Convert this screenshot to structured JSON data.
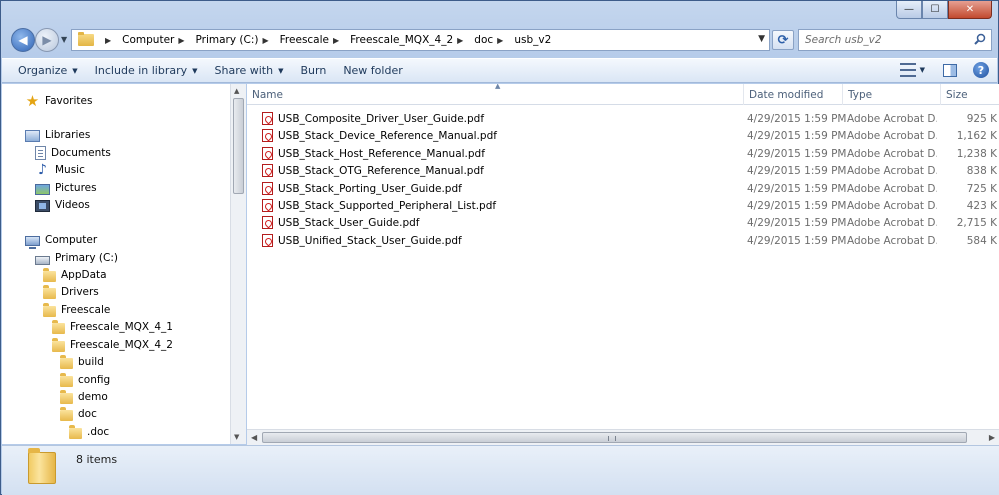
{
  "window": {
    "caption_buttons": {
      "minimize": "—",
      "maximize": "☐",
      "close": "✕"
    }
  },
  "address_bar": {
    "breadcrumbs": [
      "Computer",
      "Primary (C:)",
      "Freescale",
      "Freescale_MQX_4_2",
      "doc",
      "usb_v2"
    ]
  },
  "search": {
    "placeholder": "Search usb_v2"
  },
  "toolbar": {
    "organize": "Organize",
    "include_in_library": "Include in library",
    "share_with": "Share with",
    "burn": "Burn",
    "new_folder": "New folder",
    "help": "?"
  },
  "nav_pane": {
    "favorites": "Favorites",
    "libraries": "Libraries",
    "library_items": [
      "Documents",
      "Music",
      "Pictures",
      "Videos"
    ],
    "computer": "Computer",
    "drive": "Primary (C:)",
    "folders": [
      "AppData",
      "Drivers",
      "Freescale"
    ],
    "freescale_children": [
      "Freescale_MQX_4_1",
      "Freescale_MQX_4_2"
    ],
    "mqx42_children": [
      "build",
      "config",
      "demo",
      "doc"
    ],
    "doc_children": [
      ".doc"
    ]
  },
  "columns": {
    "name": "Name",
    "date": "Date modified",
    "type": "Type",
    "size": "Size"
  },
  "files": [
    {
      "name": "USB_Composite_Driver_User_Guide.pdf",
      "date": "4/29/2015 1:59 PM",
      "type": "Adobe Acrobat D...",
      "size": "925 K"
    },
    {
      "name": "USB_Stack_Device_Reference_Manual.pdf",
      "date": "4/29/2015 1:59 PM",
      "type": "Adobe Acrobat D...",
      "size": "1,162 K"
    },
    {
      "name": "USB_Stack_Host_Reference_Manual.pdf",
      "date": "4/29/2015 1:59 PM",
      "type": "Adobe Acrobat D...",
      "size": "1,238 K"
    },
    {
      "name": "USB_Stack_OTG_Reference_Manual.pdf",
      "date": "4/29/2015 1:59 PM",
      "type": "Adobe Acrobat D...",
      "size": "838 K"
    },
    {
      "name": "USB_Stack_Porting_User_Guide.pdf",
      "date": "4/29/2015 1:59 PM",
      "type": "Adobe Acrobat D...",
      "size": "725 K"
    },
    {
      "name": "USB_Stack_Supported_Peripheral_List.pdf",
      "date": "4/29/2015 1:59 PM",
      "type": "Adobe Acrobat D...",
      "size": "423 K"
    },
    {
      "name": "USB_Stack_User_Guide.pdf",
      "date": "4/29/2015 1:59 PM",
      "type": "Adobe Acrobat D...",
      "size": "2,715 K"
    },
    {
      "name": "USB_Unified_Stack_User_Guide.pdf",
      "date": "4/29/2015 1:59 PM",
      "type": "Adobe Acrobat D...",
      "size": "584 K"
    }
  ],
  "details": {
    "count": "8 items"
  },
  "icons": [
    "folder-icon",
    "pdf-icon",
    "star-icon",
    "library-icon",
    "computer-icon",
    "drive-icon",
    "search-icon",
    "help-icon"
  ]
}
